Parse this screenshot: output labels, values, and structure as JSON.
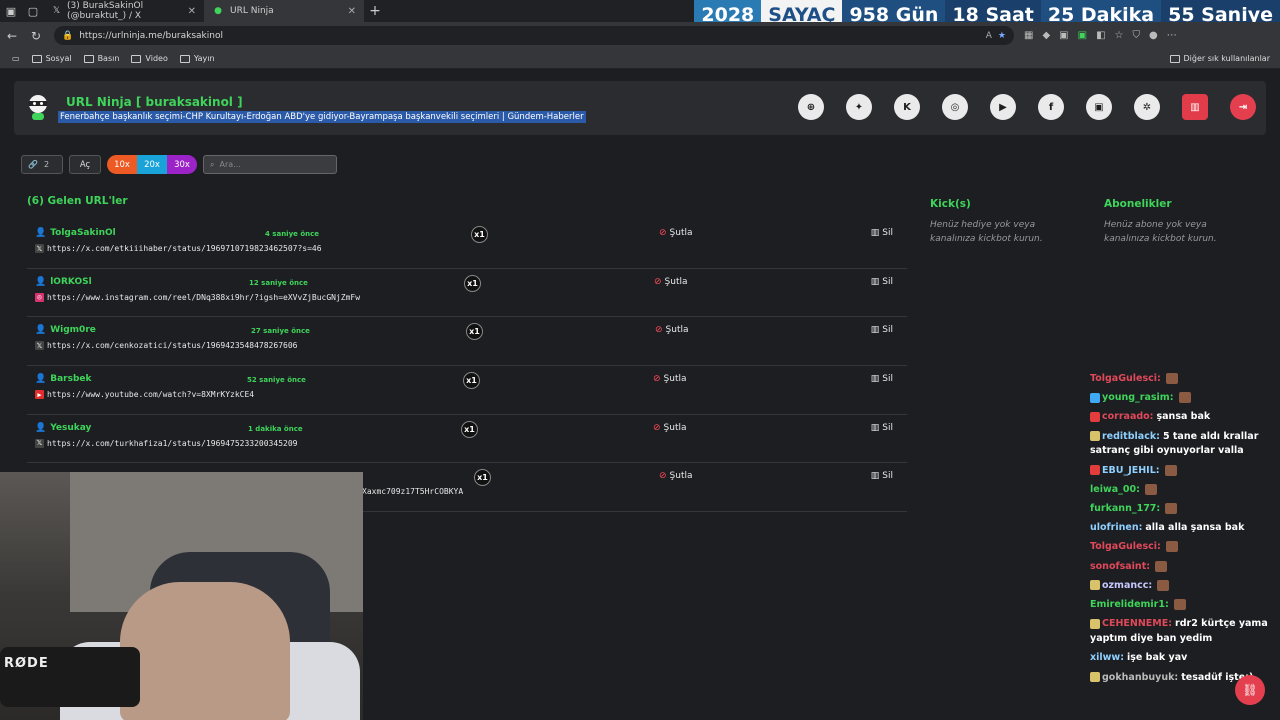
{
  "browser": {
    "tabs": [
      {
        "label": "(3) BurakSakinOl (@buraktut_) / X",
        "active": false,
        "favicon": "x-icon"
      },
      {
        "label": "URL Ninja",
        "active": true,
        "favicon": "ninja-icon"
      }
    ],
    "address": "https://urlninja.me/buraksakinol",
    "bookmarks": [
      "Sosyal",
      "Basın",
      "Video",
      "Yayın"
    ],
    "bookmarks_other": "Diğer sık kullanılanlar"
  },
  "countdown": {
    "year": "2028",
    "label": "SAYAÇ",
    "days": "958 Gün",
    "hours": "18 Saat",
    "minutes": "25 Dakika",
    "seconds": "55 Saniye"
  },
  "header": {
    "title": "URL Ninja [ buraksakinol ]",
    "now_playing": "Fenerbahçe başkanlık seçimi-CHP Kurultayı-Erdoğan ABD'ye gidiyor-Bayrampaşa başkanvekili seçimleri | Gündem-Haberler",
    "social": [
      "dribbble-icon",
      "twitter-icon",
      "kick-icon",
      "instagram-icon",
      "youtube-icon",
      "facebook-icon",
      "gallery-icon",
      "settings-icon",
      "trash-icon",
      "logout-icon"
    ]
  },
  "controls": {
    "count": "2",
    "open_label": "Aç",
    "multipliers": [
      "10x",
      "20x",
      "30x"
    ],
    "search_placeholder": "Ara..."
  },
  "list": {
    "title": "(6) Gelen URL'ler",
    "kick_label": "Şutla",
    "delete_label": "Sil",
    "rows": [
      {
        "user": "TolgaSakinOl",
        "ago": "4 saniye önce",
        "url": "https://x.com/etkiiihaber/status/1969710719823462507?s=46",
        "site": "x",
        "count": "x1"
      },
      {
        "user": "lORKOSl",
        "ago": "12 saniye önce",
        "url": "https://www.instagram.com/reel/DNq388xi9hr/?igsh=eXVvZjBucGNjZmFw",
        "site": "instagram",
        "count": "x1"
      },
      {
        "user": "Wigm0re",
        "ago": "27 saniye önce",
        "url": "https://x.com/cenkozatici/status/1969423548478267606",
        "site": "x",
        "count": "x1"
      },
      {
        "user": "Barsbek",
        "ago": "52 saniye önce",
        "url": "https://www.youtube.com/watch?v=8XMrKYzkCE4",
        "site": "youtube",
        "count": "x1"
      },
      {
        "user": "Yesukay",
        "ago": "1 dakika önce",
        "url": "https://x.com/turkhafiza1/status/1969475233200345209",
        "site": "x",
        "count": "x1"
      },
      {
        "user": "",
        "ago": "",
        "url": "Xaxmc709z17T5HrCOBKYA",
        "site": "",
        "count": "x1"
      }
    ]
  },
  "kicks": {
    "title": "Kick(s)",
    "empty": "Henüz hediye yok veya kanalınıza kickbot kurun."
  },
  "subs": {
    "title": "Abonelikler",
    "empty": "Henüz abone yok veya kanalınıza kickbot kurun."
  },
  "chat": [
    {
      "name": "TolgaGulesci:",
      "text": "",
      "color": "#e0495a",
      "badge": "",
      "emote": true
    },
    {
      "name": "young_rasim:",
      "text": "",
      "color": "#3fd45a",
      "badge": "blue",
      "emote": true
    },
    {
      "name": "corraado:",
      "text": "şansa bak",
      "color": "#e0495a",
      "badge": "red",
      "emote": false
    },
    {
      "name": "reditblack:",
      "text": "5 tane aldı krallar satranç gibi oynuyorlar valla",
      "color": "#8fd0ff",
      "badge": "gold",
      "emote": false
    },
    {
      "name": "EBU_JEHIL:",
      "text": "",
      "color": "#8fd0ff",
      "badge": "red",
      "emote": true
    },
    {
      "name": "leiwa_00:",
      "text": "",
      "color": "#3fd45a",
      "badge": "",
      "emote": true
    },
    {
      "name": "furkann_177:",
      "text": "",
      "color": "#3fd45a",
      "badge": "",
      "emote": true
    },
    {
      "name": "ulofrinen:",
      "text": "alla alla şansa bak",
      "color": "#8fd0ff",
      "badge": "",
      "emote": false
    },
    {
      "name": "TolgaGulesci:",
      "text": "",
      "color": "#e0495a",
      "badge": "",
      "emote": true
    },
    {
      "name": "sonofsaint:",
      "text": "",
      "color": "#e0495a",
      "badge": "",
      "emote": true
    },
    {
      "name": "ozmancc:",
      "text": "",
      "color": "#c7c7ff",
      "badge": "gold",
      "emote": true
    },
    {
      "name": "Emirelidemir1:",
      "text": "",
      "color": "#3fd45a",
      "badge": "",
      "emote": true
    },
    {
      "name": "CEHENNEME:",
      "text": "rdr2 kürtçe yama yaptım diye ban yedim",
      "color": "#e0495a",
      "badge": "gold",
      "emote": false
    },
    {
      "name": "xilww:",
      "text": "işe bak yav",
      "color": "#8fd0ff",
      "badge": "",
      "emote": false
    },
    {
      "name": "gokhanbuyuk:",
      "text": "tesadüf işte:)",
      "color": "#bbbbbb",
      "badge": "gold",
      "emote": false
    }
  ],
  "webcam": {
    "mic_brand": "RØDE"
  },
  "colors": {
    "accent": "#3fd45a",
    "danger": "#e33f4e",
    "bg": "#1c1e22"
  }
}
